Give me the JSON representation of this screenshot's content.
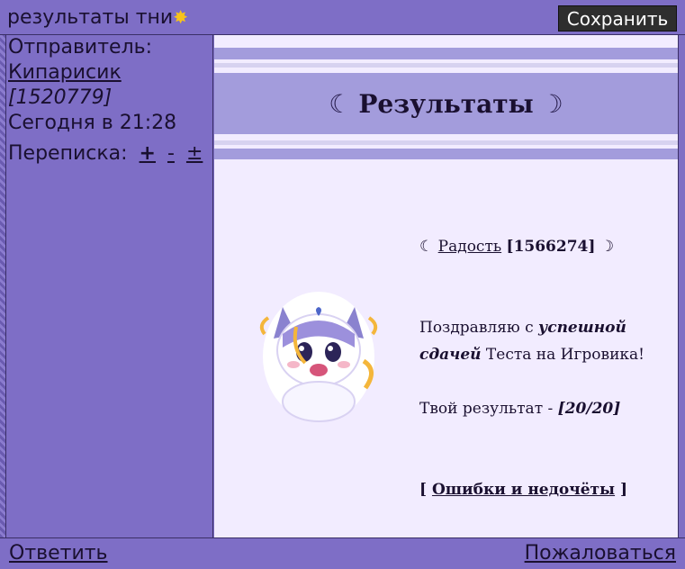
{
  "header": {
    "title": "результаты тни",
    "sun_glyph": "✸",
    "save_label": "Сохранить"
  },
  "sidebar": {
    "sender_label": "Отправитель:",
    "sender_name": "Кипарисик",
    "sender_id": "[1520779]",
    "date": "Сегодня в 21:28",
    "conversation_label": "Переписка:",
    "conv_plus": "+",
    "conv_minus": "-",
    "conv_plusminus": "±"
  },
  "message": {
    "title": "Результаты",
    "moon_left": "☾",
    "moon_right": "☽",
    "recipient_name": "Радость",
    "recipient_id": "[1566274]",
    "congrats_prefix": "Поздравляю с ",
    "congrats_emph": "успешной сдачей",
    "congrats_suffix": " Тестa на Игровика!",
    "result_label": "Твой результат - ",
    "result_value": "[20/20]",
    "errors_link": "Ошибки и недочёты"
  },
  "footer": {
    "reply_label": "Ответить",
    "report_label": "Пожаловаться"
  },
  "colors": {
    "accent": "#7e6ec6",
    "header_band": "#a39cdc",
    "message_bg": "#f2ecff"
  }
}
